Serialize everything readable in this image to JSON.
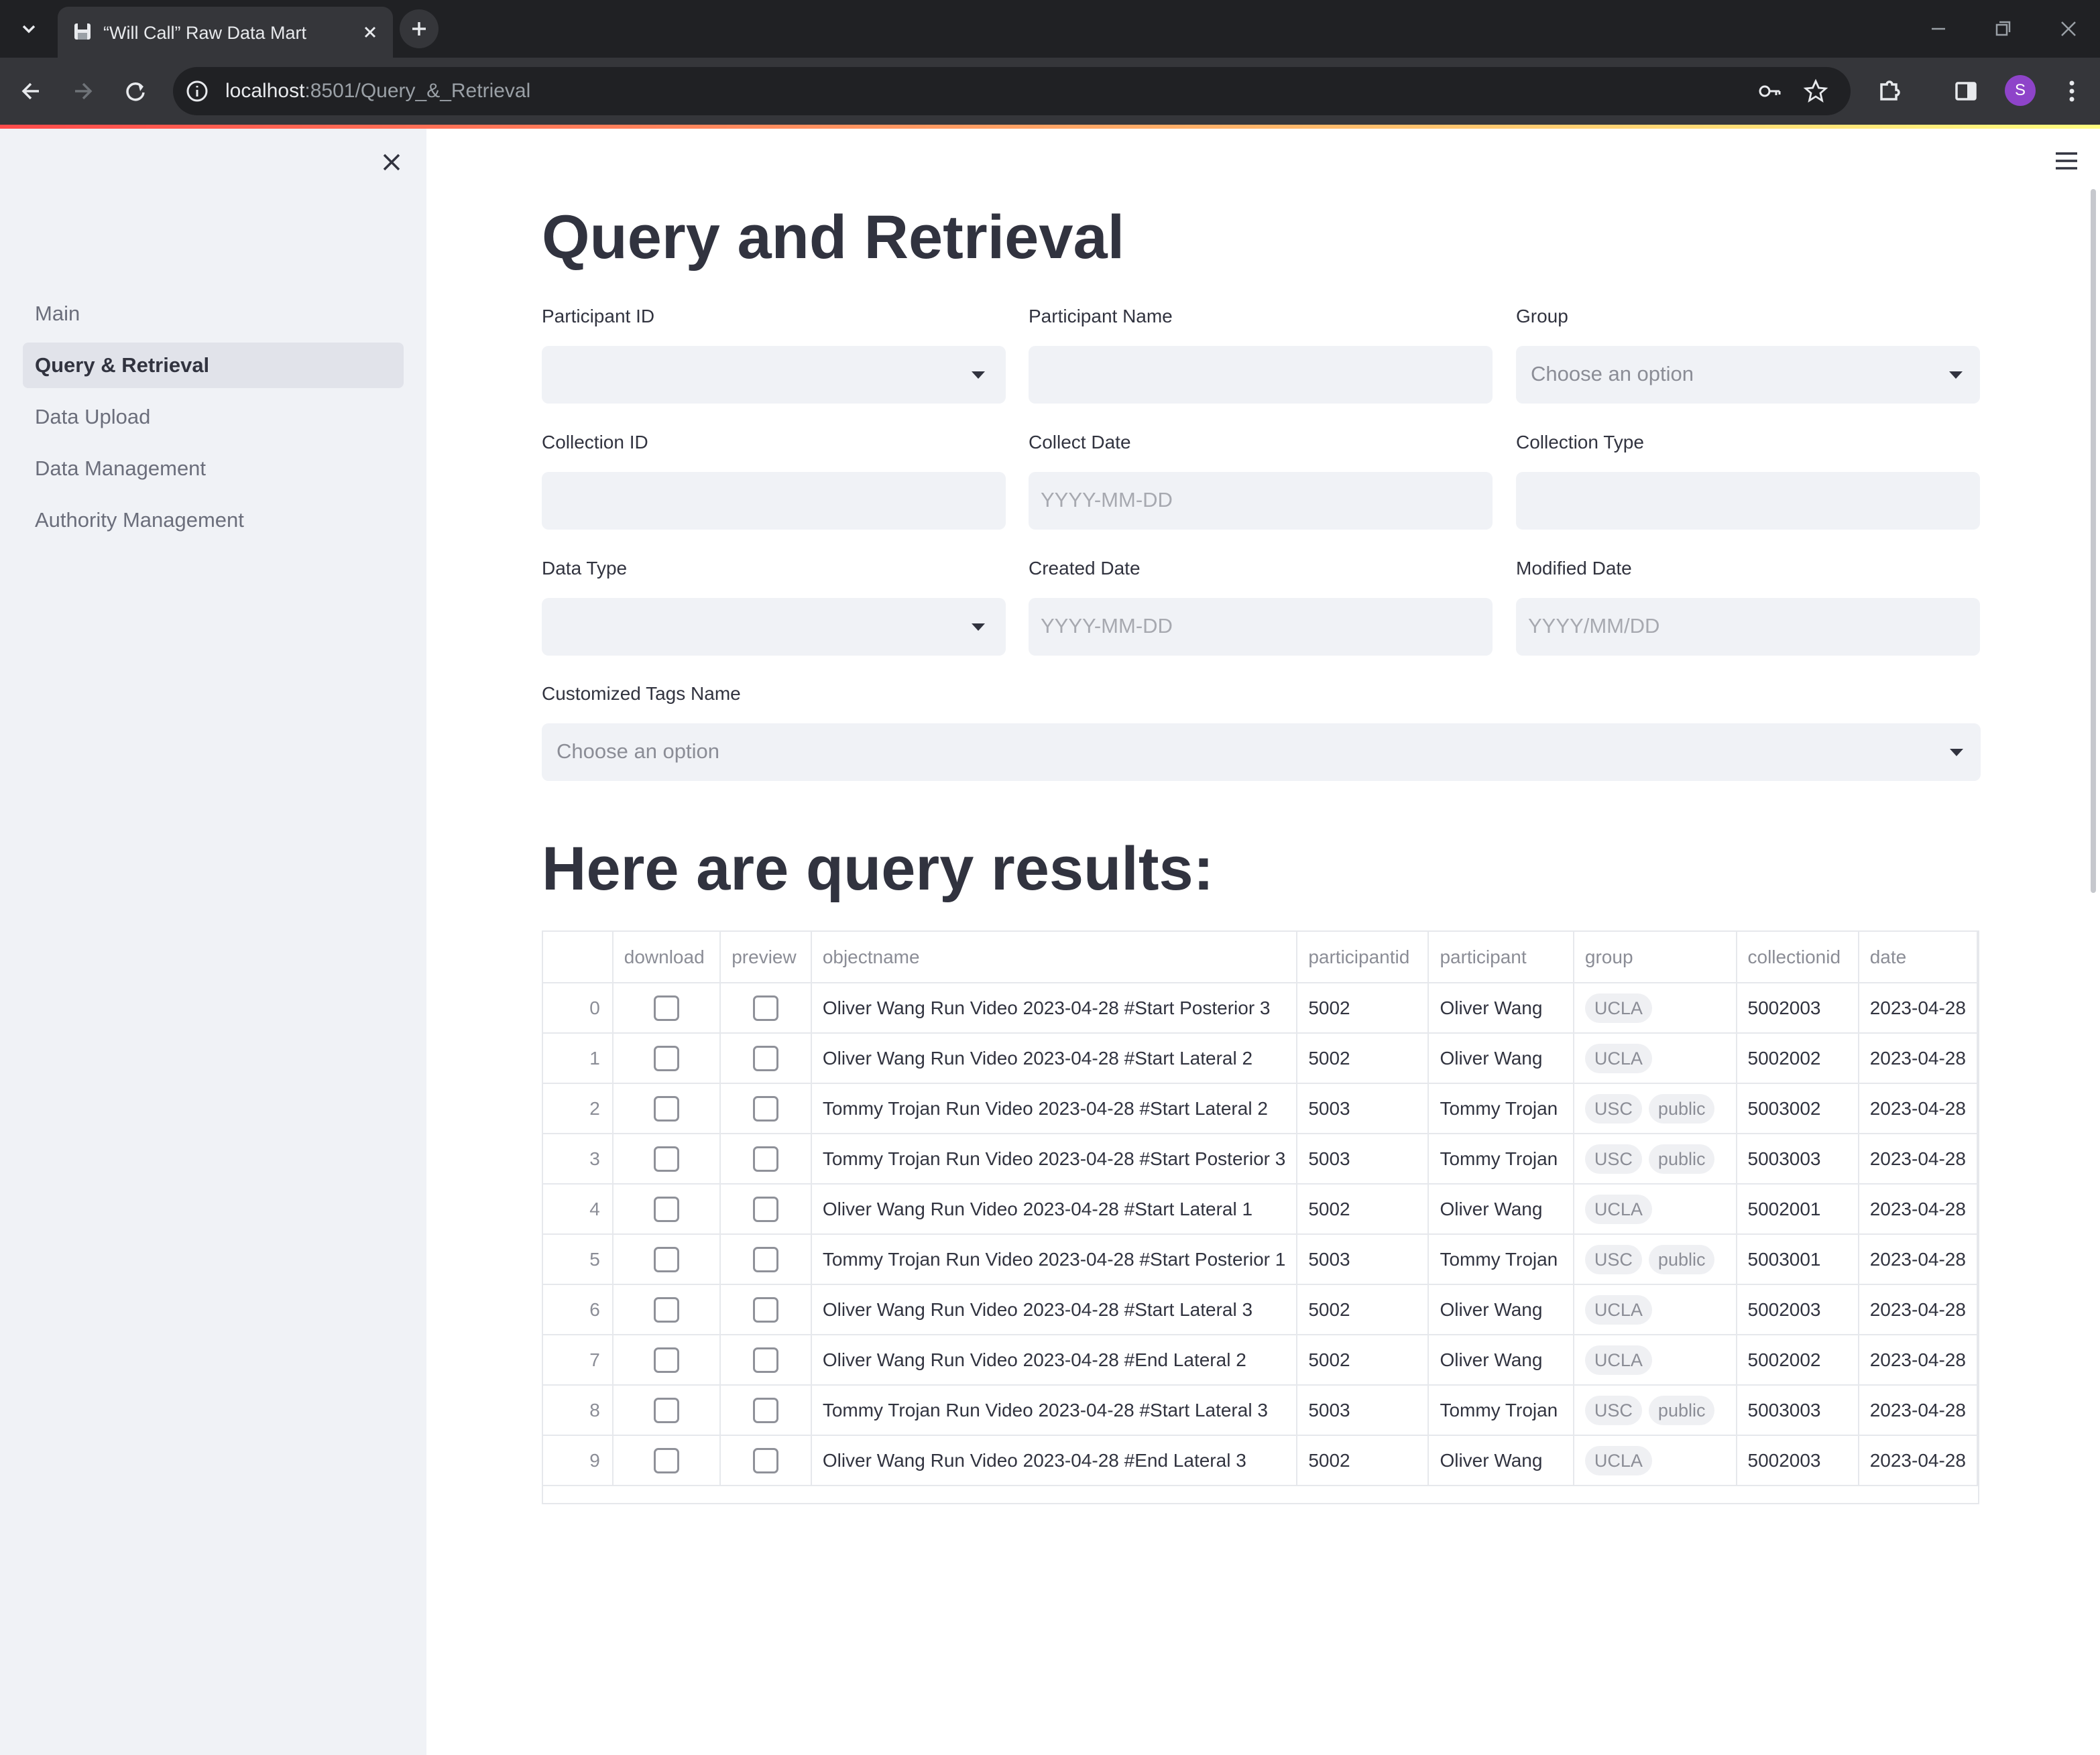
{
  "browser": {
    "tab_title": "“Will Call” Raw Data Mart",
    "url_host": "localhost",
    "url_path": ":8501/Query_&_Retrieval",
    "profile_initial": "S"
  },
  "colors": {
    "sidebar_bg": "#f0f2f6",
    "active_nav_bg": "#e1e3ea",
    "field_bg": "#f0f2f6",
    "text": "#31333f",
    "decoration_start": "#ff4b4b",
    "decoration_end": "#fffd80",
    "avatar": "#8e44c9"
  },
  "sidebar": {
    "items": [
      {
        "label": "Main",
        "active": false
      },
      {
        "label": "Query & Retrieval",
        "active": true
      },
      {
        "label": "Data Upload",
        "active": false
      },
      {
        "label": "Data Management",
        "active": false
      },
      {
        "label": "Authority Management",
        "active": false
      }
    ]
  },
  "page": {
    "title": "Query and Retrieval",
    "results_title": "Here are query results:"
  },
  "filters": {
    "participant_id": {
      "label": "Participant ID",
      "value": ""
    },
    "participant_name": {
      "label": "Participant Name",
      "value": ""
    },
    "group": {
      "label": "Group",
      "placeholder": "Choose an option"
    },
    "collection_id": {
      "label": "Collection ID",
      "value": ""
    },
    "collect_date": {
      "label": "Collect Date",
      "placeholder": "YYYY-MM-DD"
    },
    "collection_type": {
      "label": "Collection Type",
      "value": ""
    },
    "data_type": {
      "label": "Data Type",
      "value": ""
    },
    "created_date": {
      "label": "Created Date",
      "placeholder": "YYYY-MM-DD"
    },
    "modified_date": {
      "label": "Modified Date",
      "placeholder": "YYYY/MM/DD"
    },
    "tags": {
      "label": "Customized Tags Name",
      "placeholder": "Choose an option"
    }
  },
  "table": {
    "columns": [
      "",
      "download",
      "preview",
      "objectname",
      "participantid",
      "participant",
      "group",
      "collectionid",
      "date"
    ],
    "rows": [
      {
        "index": "0",
        "download": false,
        "preview": false,
        "objectname": "Oliver Wang Run Video 2023-04-28 #Start Posterior 3",
        "participantid": "5002",
        "participant": "Oliver Wang",
        "group": [
          "UCLA"
        ],
        "collectionid": "5002003",
        "date": "2023-04-28"
      },
      {
        "index": "1",
        "download": false,
        "preview": false,
        "objectname": "Oliver Wang Run Video 2023-04-28 #Start Lateral 2",
        "participantid": "5002",
        "participant": "Oliver Wang",
        "group": [
          "UCLA"
        ],
        "collectionid": "5002002",
        "date": "2023-04-28"
      },
      {
        "index": "2",
        "download": false,
        "preview": false,
        "objectname": "Tommy Trojan Run Video 2023-04-28 #Start Lateral 2",
        "participantid": "5003",
        "participant": "Tommy Trojan",
        "group": [
          "USC",
          "public"
        ],
        "collectionid": "5003002",
        "date": "2023-04-28"
      },
      {
        "index": "3",
        "download": false,
        "preview": false,
        "objectname": "Tommy Trojan Run Video 2023-04-28 #Start Posterior 3",
        "participantid": "5003",
        "participant": "Tommy Trojan",
        "group": [
          "USC",
          "public"
        ],
        "collectionid": "5003003",
        "date": "2023-04-28"
      },
      {
        "index": "4",
        "download": false,
        "preview": false,
        "objectname": "Oliver Wang Run Video 2023-04-28 #Start Lateral 1",
        "participantid": "5002",
        "participant": "Oliver Wang",
        "group": [
          "UCLA"
        ],
        "collectionid": "5002001",
        "date": "2023-04-28"
      },
      {
        "index": "5",
        "download": false,
        "preview": false,
        "objectname": "Tommy Trojan Run Video 2023-04-28 #Start Posterior 1",
        "participantid": "5003",
        "participant": "Tommy Trojan",
        "group": [
          "USC",
          "public"
        ],
        "collectionid": "5003001",
        "date": "2023-04-28"
      },
      {
        "index": "6",
        "download": false,
        "preview": false,
        "objectname": "Oliver Wang Run Video 2023-04-28 #Start Lateral 3",
        "participantid": "5002",
        "participant": "Oliver Wang",
        "group": [
          "UCLA"
        ],
        "collectionid": "5002003",
        "date": "2023-04-28"
      },
      {
        "index": "7",
        "download": false,
        "preview": false,
        "objectname": "Oliver Wang Run Video 2023-04-28 #End Lateral 2",
        "participantid": "5002",
        "participant": "Oliver Wang",
        "group": [
          "UCLA"
        ],
        "collectionid": "5002002",
        "date": "2023-04-28"
      },
      {
        "index": "8",
        "download": false,
        "preview": false,
        "objectname": "Tommy Trojan Run Video 2023-04-28 #Start Lateral 3",
        "participantid": "5003",
        "participant": "Tommy Trojan",
        "group": [
          "USC",
          "public"
        ],
        "collectionid": "5003003",
        "date": "2023-04-28"
      },
      {
        "index": "9",
        "download": false,
        "preview": false,
        "objectname": "Oliver Wang Run Video 2023-04-28 #End Lateral 3",
        "participantid": "5002",
        "participant": "Oliver Wang",
        "group": [
          "UCLA"
        ],
        "collectionid": "5002003",
        "date": "2023-04-28"
      }
    ]
  }
}
